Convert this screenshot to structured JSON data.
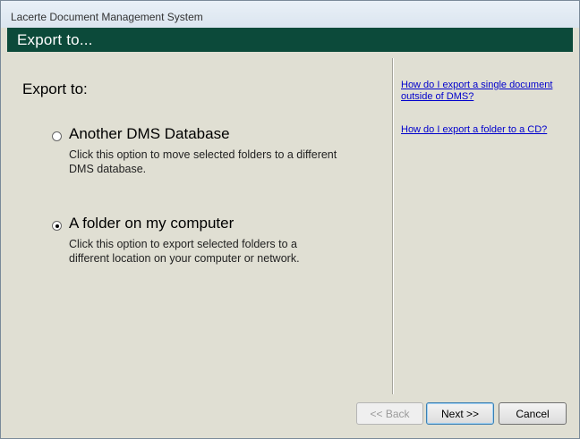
{
  "window": {
    "title": "Lacerte Document Management System"
  },
  "header": {
    "title": "Export to..."
  },
  "main": {
    "heading": "Export to:",
    "options": [
      {
        "title": "Another DMS Database",
        "description": "Click this option to move selected folders to a different DMS database.",
        "selected": false
      },
      {
        "title": "A folder on my computer",
        "description": "Click this option to export selected folders to a different location on your computer or network.",
        "selected": true
      }
    ]
  },
  "help": {
    "links": [
      "How do I export a single document outside of DMS?",
      "How do I export a folder to a CD?"
    ]
  },
  "footer": {
    "back_label": "<< Back",
    "next_label": "Next >>",
    "cancel_label": "Cancel"
  }
}
